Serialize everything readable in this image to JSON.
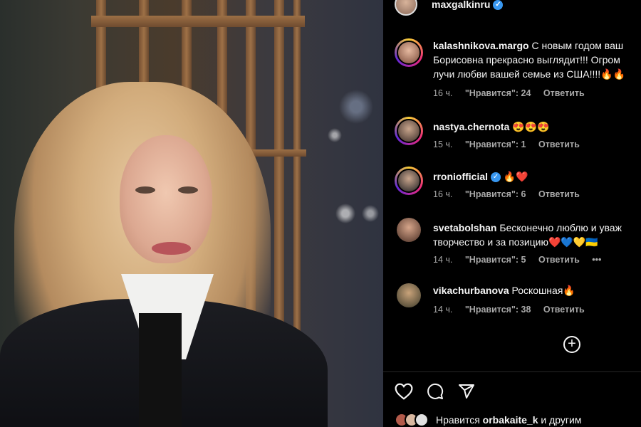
{
  "post": {
    "author": "maxgalkinru"
  },
  "comments": [
    {
      "user": "kalashnikova.margo",
      "text": "С новым годом ваш",
      "text_line2": "Борисовна прекрасно выглядит!!! Огром",
      "text_line3": "лучи любви вашей семье из США!!!!🔥🔥",
      "time": "16 ч.",
      "likes": "\"Нравится\": 24",
      "reply": "Ответить"
    },
    {
      "user": "nastya.chernota",
      "text": "😍😍😍",
      "time": "15 ч.",
      "likes": "\"Нравится\": 1",
      "reply": "Ответить"
    },
    {
      "user": "rroniofficial",
      "text": "🔥❤️",
      "time": "16 ч.",
      "likes": "\"Нравится\": 6",
      "reply": "Ответить"
    },
    {
      "user": "svetabolshan",
      "text": "Бесконечно люблю и уваж",
      "text_line2": "творчество и за позицию❤️💙💛🇺🇦",
      "time": "14 ч.",
      "likes": "\"Нравится\": 5",
      "reply": "Ответить",
      "more": "•••"
    },
    {
      "user": "vikachurbanova",
      "text": "Роскошная🔥",
      "time": "14 ч.",
      "likes": "\"Нравится\": 38",
      "reply": "Ответить"
    }
  ],
  "load_more": "+",
  "footer": {
    "likes_prefix": "Нравится",
    "likes_user": "orbakaite_k",
    "likes_suffix": "и другим"
  },
  "icons": {
    "like": "heart-icon",
    "comment": "comment-icon",
    "share": "send-icon",
    "verified": "verified-badge-icon"
  },
  "colors": {
    "verified": "#3897f0",
    "meta_text": "#a8a8a8",
    "background": "#000000"
  }
}
